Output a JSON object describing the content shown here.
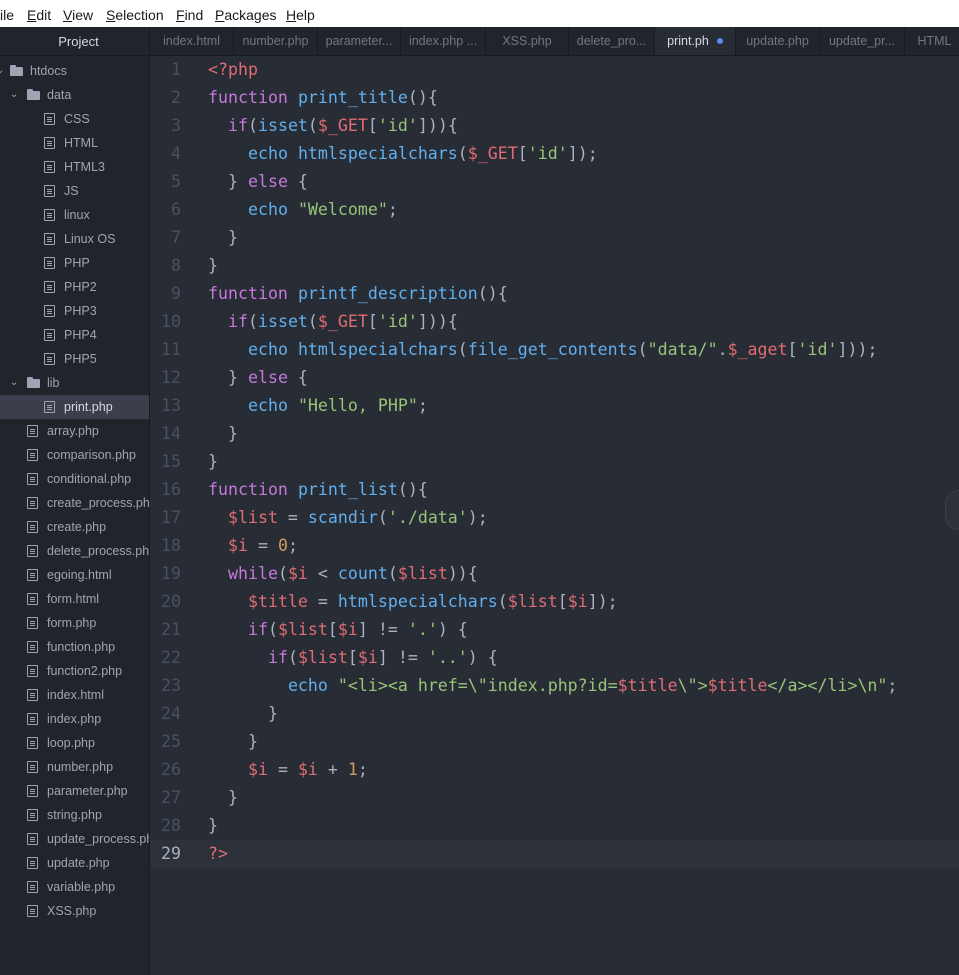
{
  "menu": [
    "ile",
    "Edit",
    "View",
    "Selection",
    "Find",
    "Packages",
    "Help"
  ],
  "sidebar": {
    "title": "Project",
    "items": [
      {
        "label": "htdocs",
        "kind": "folder",
        "depth": 0,
        "expanded": true
      },
      {
        "label": "data",
        "kind": "folder",
        "depth": 1,
        "expanded": true
      },
      {
        "label": "CSS",
        "kind": "file",
        "depth": 2
      },
      {
        "label": "HTML",
        "kind": "file",
        "depth": 2
      },
      {
        "label": "HTML3",
        "kind": "file",
        "depth": 2
      },
      {
        "label": "JS",
        "kind": "file",
        "depth": 2
      },
      {
        "label": "linux",
        "kind": "file",
        "depth": 2
      },
      {
        "label": "Linux OS",
        "kind": "file",
        "depth": 2
      },
      {
        "label": "PHP",
        "kind": "file",
        "depth": 2
      },
      {
        "label": "PHP2",
        "kind": "file",
        "depth": 2
      },
      {
        "label": "PHP3",
        "kind": "file",
        "depth": 2
      },
      {
        "label": "PHP4",
        "kind": "file",
        "depth": 2
      },
      {
        "label": "PHP5",
        "kind": "file",
        "depth": 2
      },
      {
        "label": "lib",
        "kind": "folder",
        "depth": 1,
        "expanded": true
      },
      {
        "label": "print.php",
        "kind": "file",
        "depth": 2,
        "selected": true
      },
      {
        "label": "array.php",
        "kind": "file",
        "depth": 1
      },
      {
        "label": "comparison.php",
        "kind": "file",
        "depth": 1
      },
      {
        "label": "conditional.php",
        "kind": "file",
        "depth": 1
      },
      {
        "label": "create_process.php",
        "kind": "file",
        "depth": 1
      },
      {
        "label": "create.php",
        "kind": "file",
        "depth": 1
      },
      {
        "label": "delete_process.php",
        "kind": "file",
        "depth": 1
      },
      {
        "label": "egoing.html",
        "kind": "file",
        "depth": 1
      },
      {
        "label": "form.html",
        "kind": "file",
        "depth": 1
      },
      {
        "label": "form.php",
        "kind": "file",
        "depth": 1
      },
      {
        "label": "function.php",
        "kind": "file",
        "depth": 1
      },
      {
        "label": "function2.php",
        "kind": "file",
        "depth": 1
      },
      {
        "label": "index.html",
        "kind": "file",
        "depth": 1
      },
      {
        "label": "index.php",
        "kind": "file",
        "depth": 1
      },
      {
        "label": "loop.php",
        "kind": "file",
        "depth": 1
      },
      {
        "label": "number.php",
        "kind": "file",
        "depth": 1
      },
      {
        "label": "parameter.php",
        "kind": "file",
        "depth": 1
      },
      {
        "label": "string.php",
        "kind": "file",
        "depth": 1
      },
      {
        "label": "update_process.php",
        "kind": "file",
        "depth": 1
      },
      {
        "label": "update.php",
        "kind": "file",
        "depth": 1
      },
      {
        "label": "variable.php",
        "kind": "file",
        "depth": 1
      },
      {
        "label": "XSS.php",
        "kind": "file",
        "depth": 1
      }
    ]
  },
  "tabs": [
    {
      "label": "index.html"
    },
    {
      "label": "number.php"
    },
    {
      "label": "parameter..."
    },
    {
      "label": "index.php ..."
    },
    {
      "label": "XSS.php"
    },
    {
      "label": "delete_pro..."
    },
    {
      "label": "print.ph",
      "active": true,
      "modified": true
    },
    {
      "label": "update.php"
    },
    {
      "label": "update_pr..."
    },
    {
      "label": "HTML"
    }
  ],
  "colors": {
    "keyword": "#c678dd",
    "function": "#61afef",
    "variable": "#e06c75",
    "string": "#98c379",
    "number": "#d19a66",
    "plain": "#abb2bf",
    "operator": "#56b6c2",
    "modified_dot": "#568af2"
  },
  "editor": {
    "current_line": 29,
    "lines": [
      [
        [
          "tag",
          "<?php"
        ]
      ],
      [
        [
          "kw",
          "function"
        ],
        [
          "pl",
          " "
        ],
        [
          "fn",
          "print_title"
        ],
        [
          "pl",
          "(){"
        ]
      ],
      [
        [
          "pl",
          "  "
        ],
        [
          "kw",
          "if"
        ],
        [
          "pl",
          "("
        ],
        [
          "fn",
          "isset"
        ],
        [
          "pl",
          "("
        ],
        [
          "var",
          "$_GET"
        ],
        [
          "pl",
          "["
        ],
        [
          "str",
          "'id'"
        ],
        [
          "pl",
          "])){"
        ]
      ],
      [
        [
          "pl",
          "    "
        ],
        [
          "fn",
          "echo"
        ],
        [
          "pl",
          " "
        ],
        [
          "fn",
          "htmlspecialchars"
        ],
        [
          "pl",
          "("
        ],
        [
          "var",
          "$_GET"
        ],
        [
          "pl",
          "["
        ],
        [
          "str",
          "'id'"
        ],
        [
          "pl",
          "]);"
        ]
      ],
      [
        [
          "pl",
          "  } "
        ],
        [
          "kw",
          "else"
        ],
        [
          "pl",
          " {"
        ]
      ],
      [
        [
          "pl",
          "    "
        ],
        [
          "fn",
          "echo"
        ],
        [
          "pl",
          " "
        ],
        [
          "str",
          "\"Welcome\""
        ],
        [
          "pl",
          ";"
        ]
      ],
      [
        [
          "pl",
          "  }"
        ]
      ],
      [
        [
          "pl",
          "}"
        ]
      ],
      [
        [
          "kw",
          "function"
        ],
        [
          "pl",
          " "
        ],
        [
          "fn",
          "printf_description"
        ],
        [
          "pl",
          "(){"
        ]
      ],
      [
        [
          "pl",
          "  "
        ],
        [
          "kw",
          "if"
        ],
        [
          "pl",
          "("
        ],
        [
          "fn",
          "isset"
        ],
        [
          "pl",
          "("
        ],
        [
          "var",
          "$_GET"
        ],
        [
          "pl",
          "["
        ],
        [
          "str",
          "'id'"
        ],
        [
          "pl",
          "])){"
        ]
      ],
      [
        [
          "pl",
          "    "
        ],
        [
          "fn",
          "echo"
        ],
        [
          "pl",
          " "
        ],
        [
          "fn",
          "htmlspecialchars"
        ],
        [
          "pl",
          "("
        ],
        [
          "fn",
          "file_get_contents"
        ],
        [
          "pl",
          "("
        ],
        [
          "str",
          "\"data/\""
        ],
        [
          "pl",
          "."
        ],
        [
          "var",
          "$_aget"
        ],
        [
          "pl",
          "["
        ],
        [
          "str",
          "'id'"
        ],
        [
          "pl",
          "]));"
        ]
      ],
      [
        [
          "pl",
          "  } "
        ],
        [
          "kw",
          "else"
        ],
        [
          "pl",
          " {"
        ]
      ],
      [
        [
          "pl",
          "    "
        ],
        [
          "fn",
          "echo"
        ],
        [
          "pl",
          " "
        ],
        [
          "str",
          "\"Hello, PHP\""
        ],
        [
          "pl",
          ";"
        ]
      ],
      [
        [
          "pl",
          "  }"
        ]
      ],
      [
        [
          "pl",
          "}"
        ]
      ],
      [
        [
          "kw",
          "function"
        ],
        [
          "pl",
          " "
        ],
        [
          "fn",
          "print_list"
        ],
        [
          "pl",
          "(){"
        ]
      ],
      [
        [
          "pl",
          "  "
        ],
        [
          "var",
          "$list"
        ],
        [
          "pl",
          " = "
        ],
        [
          "fn",
          "scandir"
        ],
        [
          "pl",
          "("
        ],
        [
          "str",
          "'./data'"
        ],
        [
          "pl",
          ");"
        ]
      ],
      [
        [
          "pl",
          "  "
        ],
        [
          "var",
          "$i"
        ],
        [
          "pl",
          " = "
        ],
        [
          "num",
          "0"
        ],
        [
          "pl",
          ";"
        ]
      ],
      [
        [
          "pl",
          "  "
        ],
        [
          "kw",
          "while"
        ],
        [
          "pl",
          "("
        ],
        [
          "var",
          "$i"
        ],
        [
          "pl",
          " < "
        ],
        [
          "fn",
          "count"
        ],
        [
          "pl",
          "("
        ],
        [
          "var",
          "$list"
        ],
        [
          "pl",
          ")){"
        ]
      ],
      [
        [
          "pl",
          "    "
        ],
        [
          "var",
          "$title"
        ],
        [
          "pl",
          " = "
        ],
        [
          "fn",
          "htmlspecialchars"
        ],
        [
          "pl",
          "("
        ],
        [
          "var",
          "$list"
        ],
        [
          "pl",
          "["
        ],
        [
          "var",
          "$i"
        ],
        [
          "pl",
          "]);"
        ]
      ],
      [
        [
          "pl",
          "    "
        ],
        [
          "kw",
          "if"
        ],
        [
          "pl",
          "("
        ],
        [
          "var",
          "$list"
        ],
        [
          "pl",
          "["
        ],
        [
          "var",
          "$i"
        ],
        [
          "pl",
          "] != "
        ],
        [
          "str",
          "'.'"
        ],
        [
          "pl",
          ") {"
        ]
      ],
      [
        [
          "pl",
          "      "
        ],
        [
          "kw",
          "if"
        ],
        [
          "pl",
          "("
        ],
        [
          "var",
          "$list"
        ],
        [
          "pl",
          "["
        ],
        [
          "var",
          "$i"
        ],
        [
          "pl",
          "] != "
        ],
        [
          "str",
          "'..'"
        ],
        [
          "pl",
          ") {"
        ]
      ],
      [
        [
          "pl",
          "        "
        ],
        [
          "fn",
          "echo"
        ],
        [
          "pl",
          " "
        ],
        [
          "str",
          "\"<li><a href=\\\"index.php?id="
        ],
        [
          "var",
          "$title"
        ],
        [
          "str",
          "\\\">"
        ],
        [
          "var",
          "$title"
        ],
        [
          "str",
          "</a></li>\\n\""
        ],
        [
          "pl",
          ";"
        ]
      ],
      [
        [
          "pl",
          "      }"
        ]
      ],
      [
        [
          "pl",
          "    }"
        ]
      ],
      [
        [
          "pl",
          "    "
        ],
        [
          "var",
          "$i"
        ],
        [
          "pl",
          " = "
        ],
        [
          "var",
          "$i"
        ],
        [
          "pl",
          " + "
        ],
        [
          "num",
          "1"
        ],
        [
          "pl",
          ";"
        ]
      ],
      [
        [
          "pl",
          "  }"
        ]
      ],
      [
        [
          "pl",
          "}"
        ]
      ],
      [
        [
          "tag",
          "?>"
        ]
      ]
    ]
  }
}
